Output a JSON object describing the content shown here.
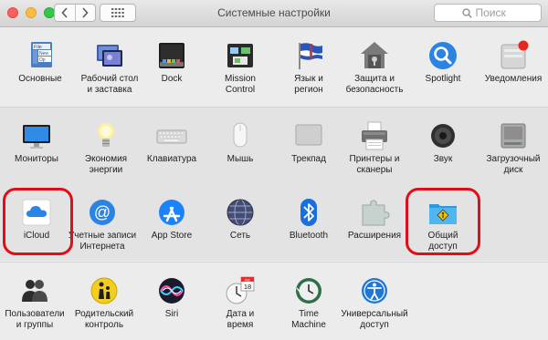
{
  "window": {
    "title": "Системные настройки",
    "search_placeholder": "Поиск",
    "back_icon": "chevron-left-icon",
    "forward_icon": "chevron-right-icon",
    "grid_icon": "show-all-grid-icon"
  },
  "colors": {
    "annotation": "#e30c18",
    "accent_blue": "#1a82fb"
  },
  "rows": [
    {
      "items": [
        {
          "label": "Основные",
          "icon": "general-icon"
        },
        {
          "label": "Рабочий стол\nи заставка",
          "icon": "desktop-screensaver-icon"
        },
        {
          "label": "Dock",
          "icon": "dock-icon"
        },
        {
          "label": "Mission\nControl",
          "icon": "mission-control-icon"
        },
        {
          "label": "Язык и\nрегион",
          "icon": "language-region-flag-icon"
        },
        {
          "label": "Защита и\nбезопасность",
          "icon": "security-house-icon"
        },
        {
          "label": "Spotlight",
          "icon": "spotlight-magnifier-icon"
        },
        {
          "label": "Уведомления",
          "icon": "notifications-icon"
        }
      ]
    },
    {
      "items": [
        {
          "label": "Мониторы",
          "icon": "displays-monitor-icon"
        },
        {
          "label": "Экономия\nэнергии",
          "icon": "energy-saver-bulb-icon"
        },
        {
          "label": "Клавиатура",
          "icon": "keyboard-icon"
        },
        {
          "label": "Мышь",
          "icon": "mouse-icon"
        },
        {
          "label": "Трекпад",
          "icon": "trackpad-icon"
        },
        {
          "label": "Принтеры и\nсканеры",
          "icon": "printer-icon"
        },
        {
          "label": "Звук",
          "icon": "speaker-icon"
        },
        {
          "label": "Загрузочный\nдиск",
          "icon": "startup-disk-icon"
        }
      ]
    },
    {
      "items": [
        {
          "label": "iCloud",
          "icon": "icloud-icon"
        },
        {
          "label": "Учетные записи\nИнтернета",
          "icon": "internet-accounts-at-icon"
        },
        {
          "label": "App Store",
          "icon": "app-store-icon"
        },
        {
          "label": "Сеть",
          "icon": "network-globe-icon"
        },
        {
          "label": "Bluetooth",
          "icon": "bluetooth-icon"
        },
        {
          "label": "Расширения",
          "icon": "extensions-puzzle-icon"
        },
        {
          "label": "Общий\nдоступ",
          "icon": "sharing-folder-icon"
        }
      ]
    },
    {
      "items": [
        {
          "label": "Пользователи\nи группы",
          "icon": "users-groups-icon"
        },
        {
          "label": "Родительский\nконтроль",
          "icon": "parental-controls-icon"
        },
        {
          "label": "Siri",
          "icon": "siri-icon"
        },
        {
          "label": "Дата и\nвремя",
          "icon": "date-time-calendar-icon",
          "calendar_month": "JUL",
          "calendar_day": "18"
        },
        {
          "label": "Time\nMachine",
          "icon": "time-machine-icon"
        },
        {
          "label": "Универсальный\nдоступ",
          "icon": "accessibility-icon"
        }
      ]
    }
  ]
}
